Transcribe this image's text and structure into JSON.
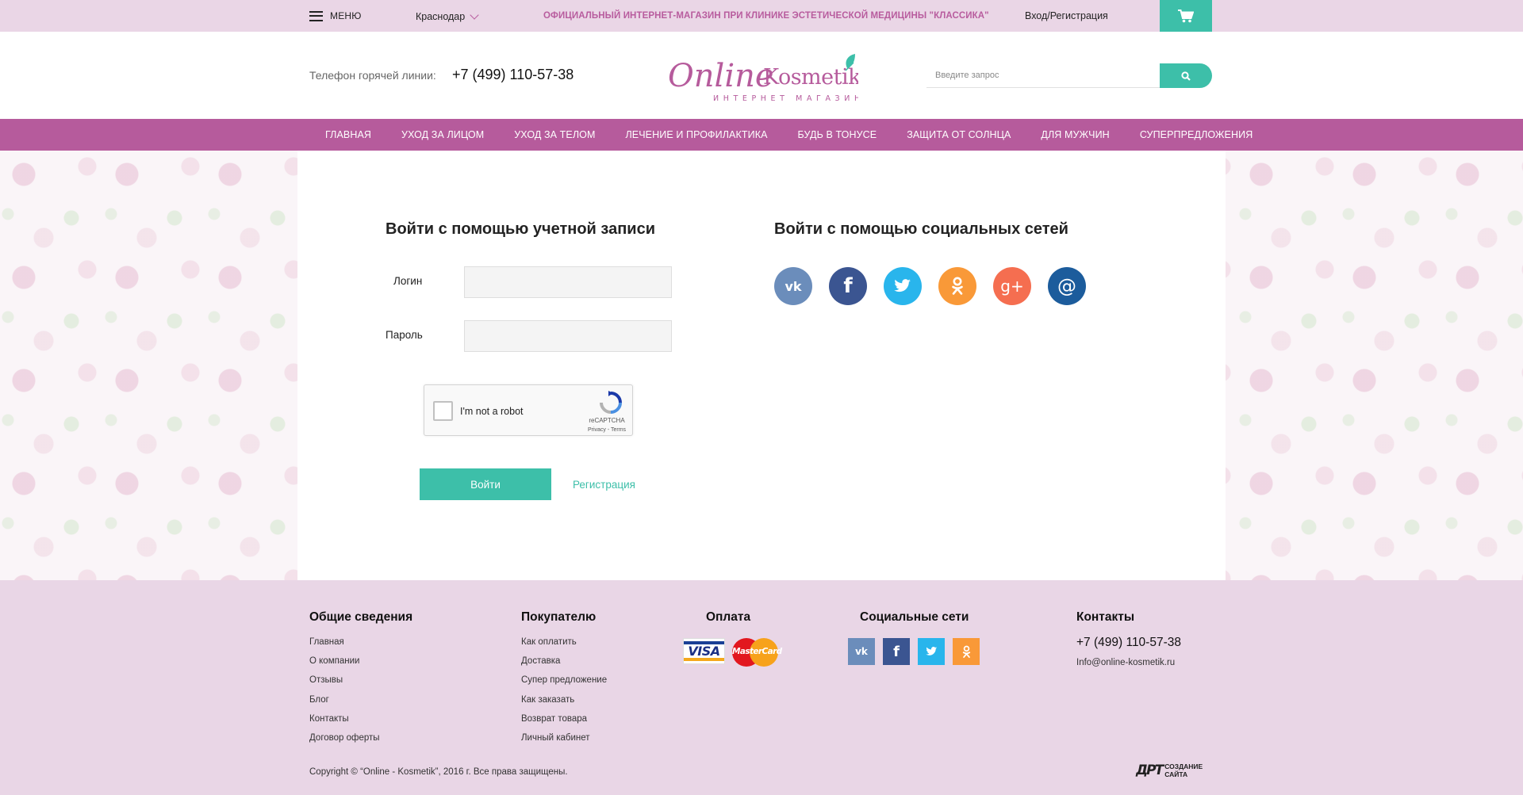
{
  "topbar": {
    "menu_label": "МЕНЮ",
    "city": "Краснодар",
    "promo": "ОФИЦИАЛЬНЫЙ ИНТЕРНЕТ-МАГАЗИН ПРИ КЛИНИКЕ ЭСТЕТИЧЕСКОЙ МЕДИЦИНЫ \"КЛАССИКА\"",
    "login_link": "Вход/Регистрация",
    "cart_icon": "cart-icon"
  },
  "header": {
    "hotline_label": "Телефон горячей линии:",
    "hotline_number": "+7 (499) 110-57-38",
    "logo_text": "Online Kosmetik",
    "logo_subtext": "ИНТЕРНЕТ МАГАЗИН",
    "search_placeholder": "Введите запрос",
    "search_icon": "search-icon"
  },
  "nav": {
    "items": [
      {
        "label": "ГЛАВНАЯ"
      },
      {
        "label": "УХОД ЗА ЛИЦОМ"
      },
      {
        "label": "УХОД ЗА ТЕЛОМ"
      },
      {
        "label": "ЛЕЧЕНИЕ И ПРОФИЛАКТИКА"
      },
      {
        "label": "БУДЬ В ТОНУСЕ"
      },
      {
        "label": "ЗАЩИТА ОТ СОЛНЦА"
      },
      {
        "label": "ДЛЯ МУЖЧИН"
      },
      {
        "label": "СУПЕРПРЕДЛОЖЕНИЯ"
      }
    ]
  },
  "login": {
    "account_title": "Войти с помощью учетной записи",
    "login_label": "Логин",
    "password_label": "Пароль",
    "login_value": "",
    "password_value": "",
    "captcha_text": "I'm not a robot",
    "captcha_brand": "reCAPTCHA",
    "captcha_links": "Privacy - Terms",
    "submit_label": "Войти",
    "register_label": "Регистрация"
  },
  "social": {
    "title": "Войти с помощью социальных сетей",
    "networks": [
      {
        "icon": "vk-icon",
        "glyph": "vk",
        "color": "#6b8dbb"
      },
      {
        "icon": "facebook-icon",
        "glyph": "f",
        "color": "#3b5591"
      },
      {
        "icon": "twitter-icon",
        "glyph": "",
        "color": "#29b5ec"
      },
      {
        "icon": "odnoklassniki-icon",
        "glyph": "",
        "color": "#f99938"
      },
      {
        "icon": "google-plus-icon",
        "glyph": "g+",
        "color": "#f56e50"
      },
      {
        "icon": "mail-ru-icon",
        "glyph": "@",
        "color": "#1c5c9c"
      }
    ]
  },
  "footer": {
    "general": {
      "title": "Общие сведения",
      "links": [
        "Главная",
        "О компании",
        "Отзывы",
        "Блог",
        "Контакты",
        "Договор оферты"
      ]
    },
    "buyer": {
      "title": "Покупателю",
      "links": [
        "Как оплатить",
        "Доставка",
        "Супер предложение",
        "Как заказать",
        "Возврат товара",
        "Личный кабинет"
      ]
    },
    "payment": {
      "title": "Оплата",
      "visa": "VISA",
      "mastercard": "MasterCard"
    },
    "social": {
      "title": "Социальные сети",
      "vk": "vk",
      "fb": "f"
    },
    "contacts": {
      "title": "Контакты",
      "phone": "+7 (499) 110-57-38",
      "email": "Info@online-kosmetik.ru"
    },
    "copyright": "Copyright © “Online - Kosmetik”, 2016 г.  Все права защищены.",
    "developer_mark": "ДРТ",
    "developer_line1": "СОЗДАНИЕ",
    "developer_line2": "САЙТА"
  },
  "colors": {
    "accent_teal": "#3dbfa9",
    "nav_purple": "#b65b9c",
    "topbar_bg": "#ead6e6",
    "footer_bg": "#e9d6e6"
  }
}
